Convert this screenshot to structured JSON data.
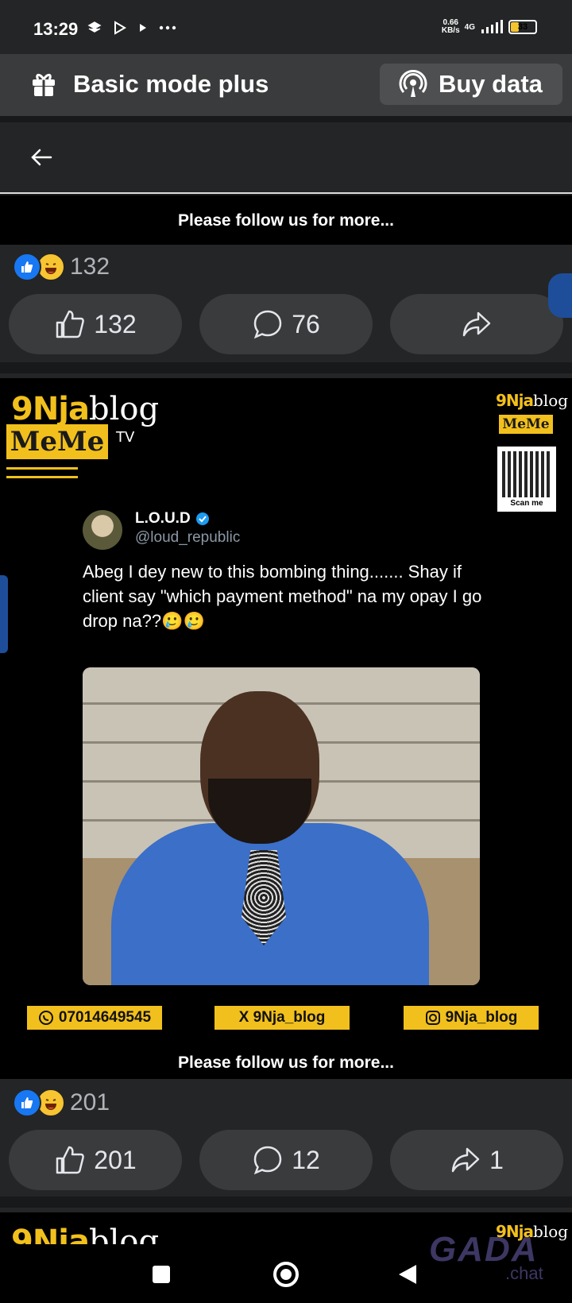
{
  "status_bar": {
    "time": "13:29",
    "speed_value": "0.66",
    "speed_unit": "KB/s",
    "network": "4G",
    "battery": "33",
    "battery_level": 0.33
  },
  "mode_bar": {
    "title": "Basic mode plus",
    "buy_data_label": "Buy data"
  },
  "post1": {
    "image_caption": "Please follow us for more...",
    "reaction_count": "132",
    "like_count": "132",
    "comment_count": "76",
    "share_count": ""
  },
  "post2": {
    "brand": {
      "nja": "9Nja",
      "blog": "blog",
      "meme": "MeMe",
      "tv": "TV",
      "scan": "Scan me"
    },
    "tweet": {
      "name": "L.O.U.D",
      "handle": "@loud_republic",
      "text": "Abeg I dey new to this bombing thing....... Shay if client say \"which payment method\" na my opay I go drop na??🥲🥲"
    },
    "contacts": {
      "whatsapp": "07014649545",
      "x": "X 9Nja_blog",
      "instagram": "9Nja_blog"
    },
    "image_caption": "Please follow us for more...",
    "reaction_count": "201",
    "like_count": "201",
    "comment_count": "12",
    "share_count": "1"
  },
  "watermark": {
    "main": "GADA",
    "sub": ".chat"
  },
  "colors": {
    "brand_yellow": "#f2c01c",
    "fb_blue": "#1877f2",
    "surface": "#242526",
    "button": "#3a3b3c"
  }
}
